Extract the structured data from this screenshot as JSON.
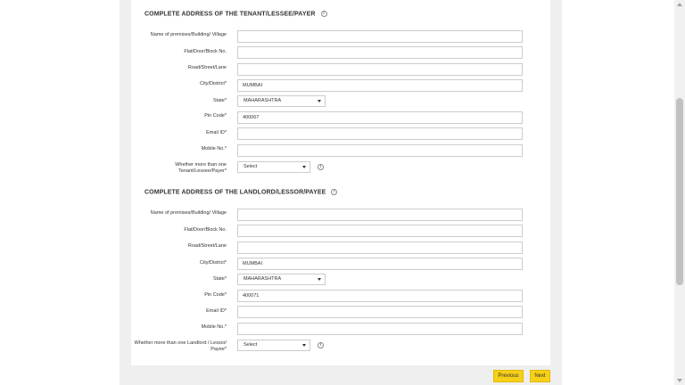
{
  "tenant": {
    "title": "COMPLETE ADDRESS OF THE TENANT/LESSEE/PAYER",
    "premises_label": "Name of premises/Building/ Village",
    "premises_value": "",
    "flat_label": "Flat/Door/Block No.",
    "flat_value": "",
    "road_label": "Road/Street/Lane",
    "road_value": "",
    "city_label": "City/District*",
    "city_value": "MUMBAI",
    "state_label": "State*",
    "state_value": "MAHARASHTRA",
    "pin_label": "Pin Code*",
    "pin_value": "400067",
    "email_label": "Email ID*",
    "email_value": "",
    "mobile_label": "Mobile No.*",
    "mobile_value": "",
    "multiple_label": "Whether more than one Tenant/Lessee/Payer*",
    "multiple_value": "Select"
  },
  "landlord": {
    "title": "COMPLETE ADDRESS OF THE LANDLORD/LESSOR/PAYEE",
    "premises_label": "Name of premises/Building/ Village",
    "premises_value": "",
    "flat_label": "Flat/Door/Block No.",
    "flat_value": "",
    "road_label": "Road/Street/Lane",
    "road_value": "",
    "city_label": "City/District*",
    "city_value": "MUMBAI",
    "state_label": "State*",
    "state_value": "MAHARASHTRA",
    "pin_label": "Pin Code*",
    "pin_value": "400071",
    "email_label": "Email ID*",
    "email_value": "",
    "mobile_label": "Mobile No.*",
    "mobile_value": "",
    "multiple_label": "Whether more than one Landlord / Lessor/ Payee*",
    "multiple_value": "Select"
  },
  "info_glyph": "i",
  "buttons": {
    "previous": "Previous",
    "next": "Next"
  },
  "colors": {
    "button_bg": "#f7d117",
    "page_bg": "#efefef"
  }
}
